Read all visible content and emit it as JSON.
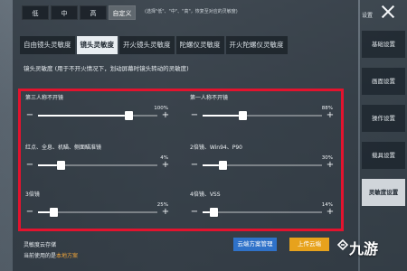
{
  "presets": {
    "items": [
      "低",
      "中",
      "高",
      "自定义"
    ],
    "active_index": 3,
    "hint": "(选择\"低\"、\"中\"、\"高\"，恢复至对应的灵敏度)"
  },
  "tabs": {
    "items": [
      "自由镜头灵敏度",
      "镜头灵敏度",
      "开火镜头灵敏度",
      "陀螺仪灵敏度",
      "开火陀螺仪灵敏度"
    ],
    "active_index": 1
  },
  "section": {
    "title": "镜头灵敏度  (用于不开火情况下，划动屏幕时镜头转动的灵敏度)"
  },
  "sliders": [
    {
      "label": "第三人称不开镜",
      "value_text": "100%",
      "level": 0.76
    },
    {
      "label": "第一人称不开镜",
      "value_text": "88%",
      "level": 0.33
    },
    {
      "label": "红点、全息、机瞄、侧面瞄准镜",
      "value_text": "4%",
      "level": 0.19
    },
    {
      "label": "2倍镜、Win94、P90",
      "value_text": "30%",
      "level": 0.17
    },
    {
      "label": "3倍镜",
      "value_text": "25%",
      "level": 0.13
    },
    {
      "label": "4倍镜、VSS",
      "value_text": "14%",
      "level": 0.09
    }
  ],
  "cloud": {
    "label": "灵敏度云存储",
    "current_prefix": "当前使用的是",
    "current_value": "本地方案",
    "manage_label": "云端方案管理",
    "upload_label": "上传云端"
  },
  "sidebar": {
    "top_label": "设置",
    "items": [
      "基础设置",
      "画面设置",
      "操作设置",
      "载具设置",
      "灵敏度设置"
    ],
    "active_index": 4
  },
  "watermark": "九游",
  "colors": {
    "highlight_box": "#e3132e",
    "upload_button": "#e7a21c",
    "manage_button": "#2f72c9",
    "current_scheme": "#f0a53a"
  }
}
